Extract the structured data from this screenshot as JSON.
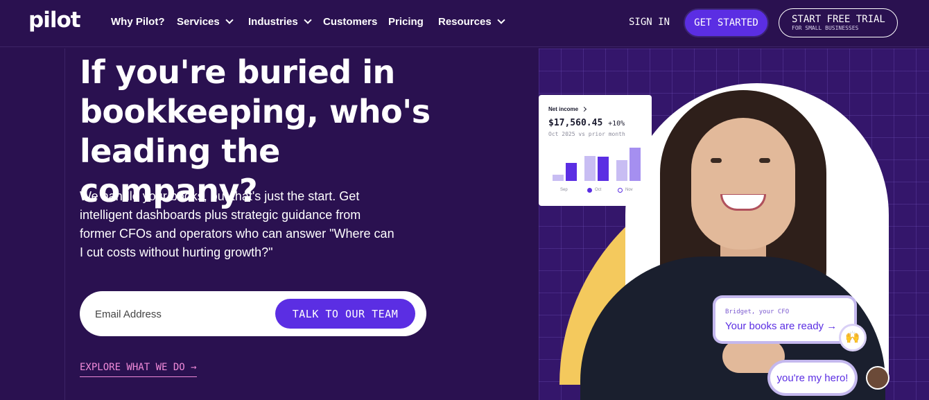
{
  "nav": {
    "logo": "pilot",
    "links": [
      {
        "label": "Why Pilot?",
        "has_dropdown": false
      },
      {
        "label": "Services",
        "has_dropdown": true
      },
      {
        "label": "Industries",
        "has_dropdown": true
      },
      {
        "label": "Customers",
        "has_dropdown": false
      },
      {
        "label": "Pricing",
        "has_dropdown": false
      },
      {
        "label": "Resources",
        "has_dropdown": true
      }
    ],
    "sign_in": "SIGN IN",
    "get_started": "GET STARTED",
    "trial_title": "START FREE TRIAL",
    "trial_sub": "FOR SMALL BUSINESSES"
  },
  "hero": {
    "title": "If you're buried in bookkeeping, who's leading the company?",
    "subtitle": "We handle your books, but that's just the start. Get intelligent dashboards plus strategic guidance from former CFOs and operators who can answer \"Where can I cut costs without hurting growth?\"",
    "email_placeholder": "Email Address",
    "cta": "TALK TO OUR TEAM",
    "explore": "EXPLORE WHAT WE DO →"
  },
  "card": {
    "label": "Net income",
    "value": "$17,560.45",
    "change": "+10%",
    "period": "Oct 2025 vs prior month",
    "legend": [
      "Sep",
      "Oct",
      "Nov"
    ],
    "bars": [
      {
        "month": "Sep",
        "prior": 0.18,
        "current": 0.55
      },
      {
        "month": "Oct",
        "prior": 0.75,
        "current": 0.72
      },
      {
        "month": "Nov",
        "prior": 0.62,
        "current": 1.0
      }
    ]
  },
  "chat": {
    "cfo_name": "Bridget, your CFO",
    "message": "Your books are ready →",
    "emoji": "🙌",
    "reply": "you're my hero!"
  },
  "colors": {
    "background": "#2a1150",
    "accent": "#5b2ee3",
    "link_pink": "#f08ad9",
    "yellow": "#f4c95d"
  }
}
